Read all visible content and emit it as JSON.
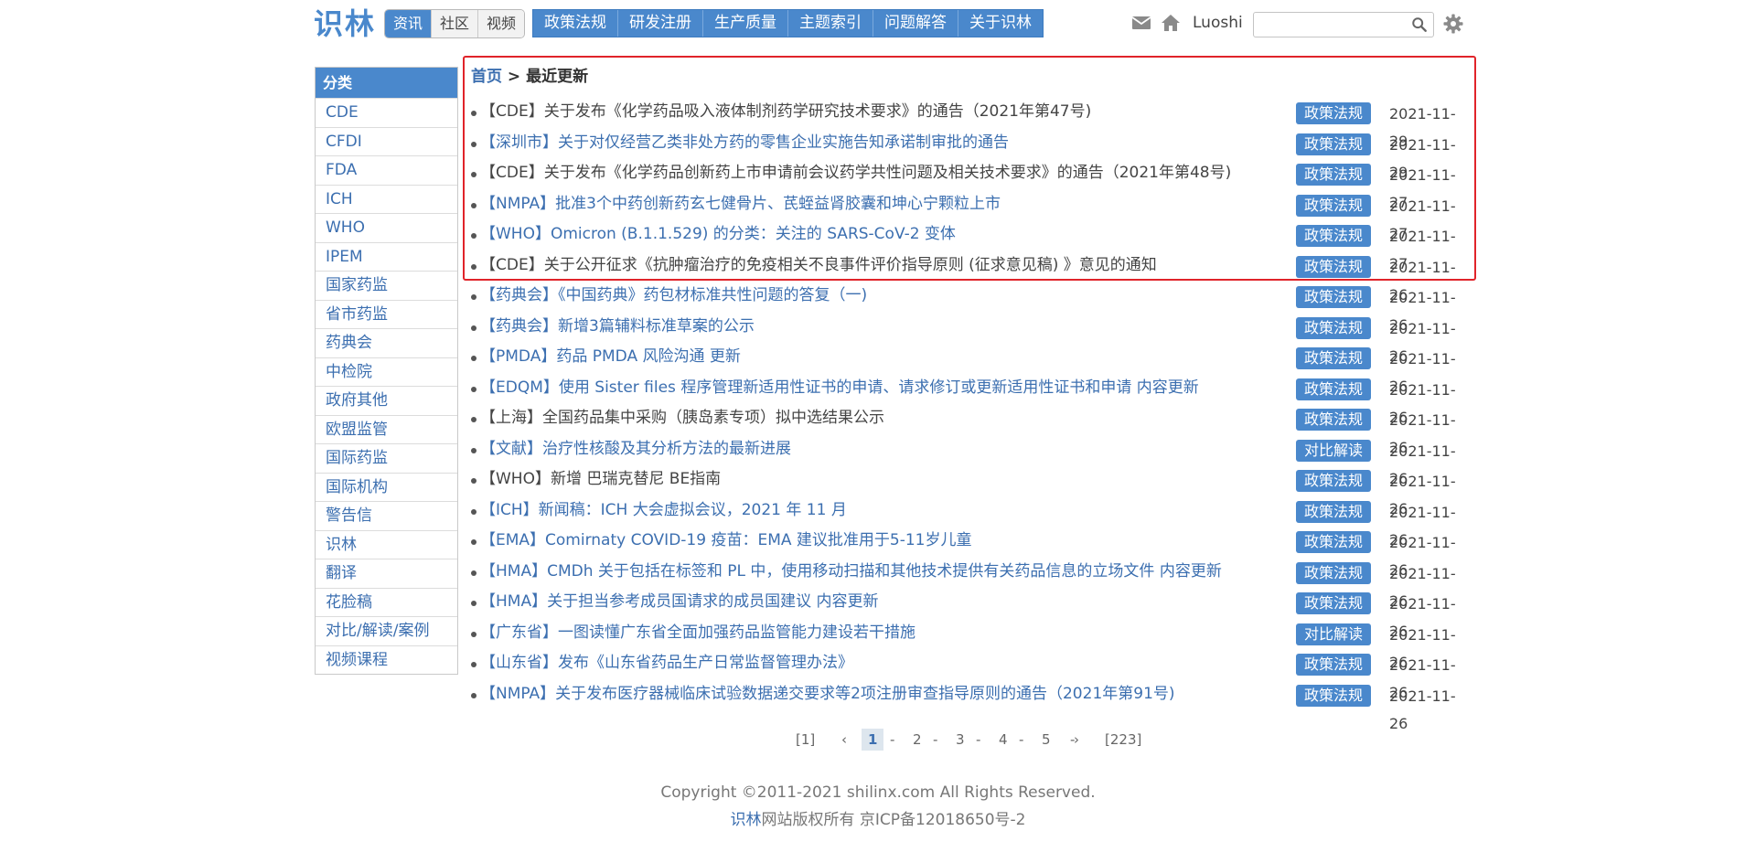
{
  "header": {
    "logo": "识林",
    "segments": [
      "资讯",
      "社区",
      "视频"
    ],
    "nav": [
      "政策法规",
      "研发注册",
      "生产质量",
      "主题索引",
      "问题解答",
      "关于识林"
    ],
    "username": "Luoshi",
    "search_placeholder": ""
  },
  "sidebar": {
    "heading": "分类",
    "items": [
      "CDE",
      "CFDI",
      "FDA",
      "ICH",
      "WHO",
      "IPEM",
      "国家药监",
      "省市药监",
      "药典会",
      "中检院",
      "政府其他",
      "欧盟监管",
      "国际药监",
      "国际机构",
      "警告信",
      "识林",
      "翻译",
      "花脸稿",
      "对比/解读/案例",
      "视频课程"
    ]
  },
  "breadcrumb": {
    "home": "首页",
    "separator": ">",
    "current": "最近更新"
  },
  "articles": [
    {
      "title": "【CDE】关于发布《化学药品吸入液体制剂药学研究技术要求》的通告（2021年第47号)",
      "tag": "政策法规",
      "date": "2021-11-29",
      "visited": true
    },
    {
      "title": "【深圳市】关于对仅经营乙类非处方药的零售企业实施告知承诺制审批的通告",
      "tag": "政策法规",
      "date": "2021-11-29",
      "visited": false
    },
    {
      "title": "【CDE】关于发布《化学药品创新药上市申请前会议药学共性问题及相关技术要求》的通告（2021年第48号)",
      "tag": "政策法规",
      "date": "2021-11-27",
      "visited": true
    },
    {
      "title": "【NMPA】批准3个中药创新药玄七健骨片、芪蛭益肾胶囊和坤心宁颗粒上市",
      "tag": "政策法规",
      "date": "2021-11-27",
      "visited": false
    },
    {
      "title": "【WHO】Omicron (B.1.1.529) 的分类：关注的 SARS-CoV-2 变体",
      "tag": "政策法规",
      "date": "2021-11-27",
      "visited": false
    },
    {
      "title": "【CDE】关于公开征求《抗肿瘤治疗的免疫相关不良事件评价指导原则 (征求意见稿) 》意见的通知",
      "tag": "政策法规",
      "date": "2021-11-26",
      "visited": true
    },
    {
      "title": "【药典会】《中国药典》药包材标准共性问题的答复（一)",
      "tag": "政策法规",
      "date": "2021-11-26",
      "visited": false
    },
    {
      "title": "【药典会】新增3篇辅料标准草案的公示",
      "tag": "政策法规",
      "date": "2021-11-26",
      "visited": false
    },
    {
      "title": "【PMDA】药品 PMDA 风险沟通 更新",
      "tag": "政策法规",
      "date": "2021-11-26",
      "visited": false
    },
    {
      "title": "【EDQM】使用 Sister files 程序管理新适用性证书的申请、请求修订或更新适用性证书和申请 内容更新",
      "tag": "政策法规",
      "date": "2021-11-26",
      "visited": false
    },
    {
      "title": "【上海】全国药品集中采购（胰岛素专项）拟中选结果公示",
      "tag": "政策法规",
      "date": "2021-11-26",
      "visited": true
    },
    {
      "title": "【文献】治疗性核酸及其分析方法的最新进展",
      "tag": "对比解读",
      "date": "2021-11-26",
      "visited": false
    },
    {
      "title": "【WHO】新增 巴瑞克替尼 BE指南",
      "tag": "政策法规",
      "date": "2021-11-26",
      "visited": true
    },
    {
      "title": "【ICH】新闻稿：ICH 大会虚拟会议，2021 年 11 月",
      "tag": "政策法规",
      "date": "2021-11-26",
      "visited": false
    },
    {
      "title": "【EMA】Comirnaty COVID-19 疫苗：EMA 建议批准用于5-11岁儿童",
      "tag": "政策法规",
      "date": "2021-11-26",
      "visited": false
    },
    {
      "title": "【HMA】CMDh 关于包括在标签和 PL 中，使用移动扫描和其他技术提供有关药品信息的立场文件 内容更新",
      "tag": "政策法规",
      "date": "2021-11-26",
      "visited": false
    },
    {
      "title": "【HMA】关于担当参考成员国请求的成员国建议 内容更新",
      "tag": "政策法规",
      "date": "2021-11-26",
      "visited": false
    },
    {
      "title": "【广东省】一图读懂广东省全面加强药品监管能力建设若干措施",
      "tag": "对比解读",
      "date": "2021-11-26",
      "visited": false
    },
    {
      "title": "【山东省】发布《山东省药品生产日常监督管理办法》",
      "tag": "政策法规",
      "date": "2021-11-26",
      "visited": false
    },
    {
      "title": "【NMPA】关于发布医疗器械临床试验数据递交要求等2项注册审查指导原则的通告（2021年第91号)",
      "tag": "政策法规",
      "date": "2021-11-26",
      "visited": false
    }
  ],
  "pagination": {
    "first": "[1]",
    "prev": "‹",
    "pages": [
      "1",
      "2",
      "3",
      "4",
      "5"
    ],
    "separators": [
      "-",
      "-",
      "-",
      "-",
      "-"
    ],
    "next": "›",
    "last": "[223]"
  },
  "footer": {
    "copyright": "Copyright ©2011-2021 shilinx.com All Rights Reserved.",
    "brand": "识林",
    "license": "网站版权所有 京ICP备12018650号-2"
  },
  "colors": {
    "accent": "#4a88cc",
    "link": "#3c6fb0",
    "highlight_border": "#e0242a"
  },
  "icons": [
    "mail-icon",
    "home-icon",
    "search-icon",
    "gear-icon"
  ]
}
